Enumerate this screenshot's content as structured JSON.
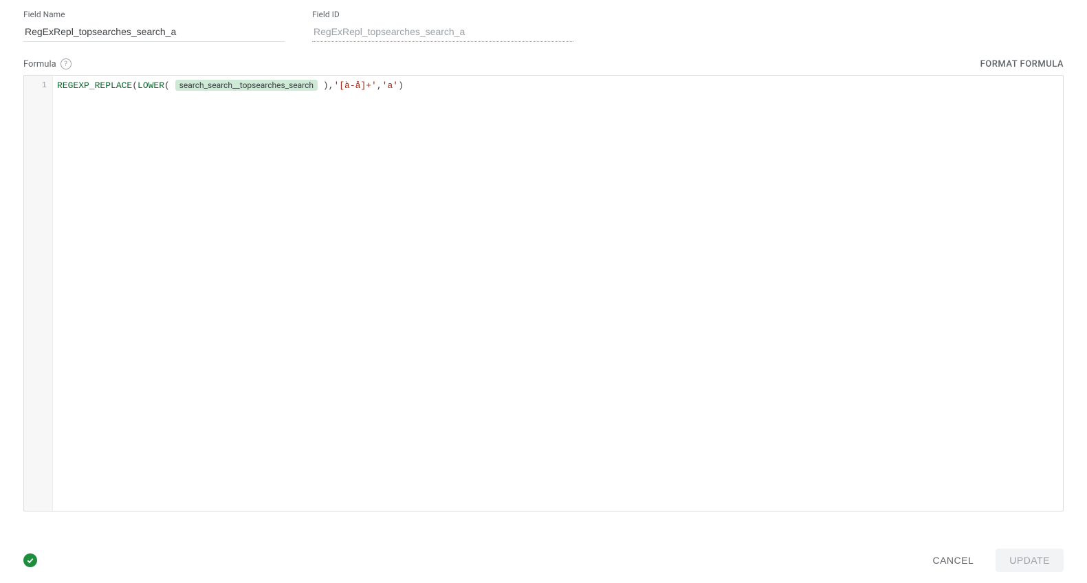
{
  "fields": {
    "name_label": "Field Name",
    "name_value": "RegExRepl_topsearches_search_a",
    "id_label": "Field ID",
    "id_value": "RegExRepl_topsearches_search_a"
  },
  "formula": {
    "label": "Formula",
    "format_btn": "FORMAT FORMULA",
    "line_number": "1",
    "tokens": {
      "func1": "REGEXP_REPLACE",
      "paren_open1": "(",
      "func2": "LOWER",
      "paren_open2": "(",
      "chip": "search_search__topsearches_search",
      "paren_close1": ")",
      "comma1": ",",
      "str1": "'[à-å]+'",
      "comma2": ",",
      "str2": "'a'",
      "paren_close2": ")"
    }
  },
  "footer": {
    "cancel": "CANCEL",
    "update": "UPDATE"
  }
}
